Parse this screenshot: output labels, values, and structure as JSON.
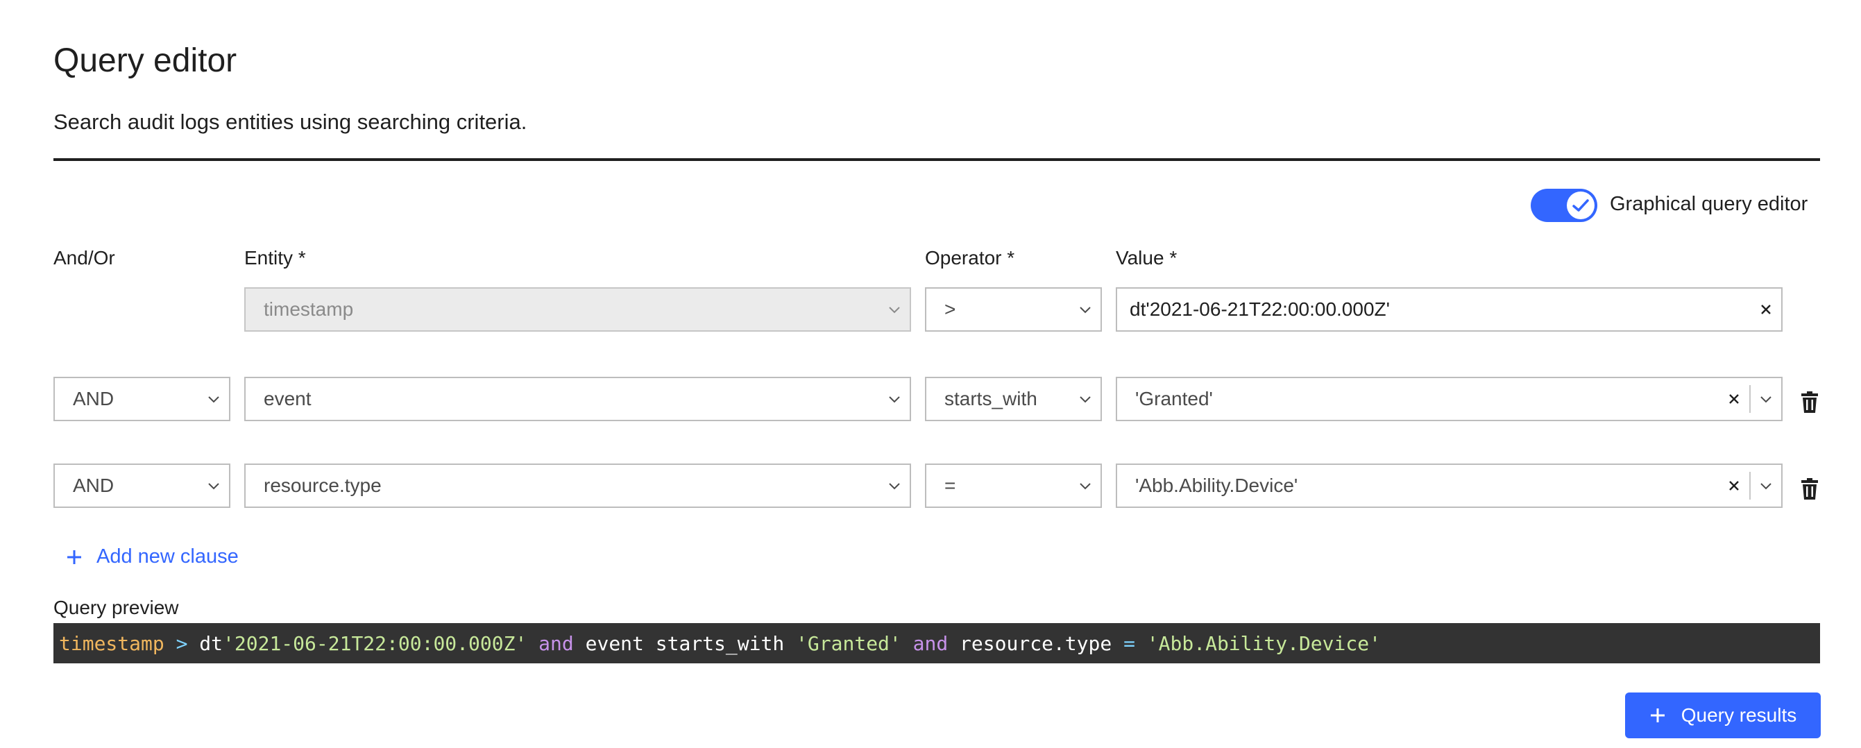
{
  "header": {
    "title": "Query editor",
    "subtitle": "Search audit logs entities using searching criteria."
  },
  "toggle": {
    "label": "Graphical query editor",
    "checked": true,
    "color": "#3366ff"
  },
  "columns": {
    "andor": "And/Or",
    "entity": "Entity *",
    "operator": "Operator *",
    "value": "Value *"
  },
  "clauses": [
    {
      "andor": "",
      "entity": "timestamp",
      "operator": ">",
      "value": "dt'2021-06-21T22:00:00.000Z'"
    },
    {
      "andor": "AND",
      "entity": "event",
      "operator": "starts_with",
      "value": "'Granted'"
    },
    {
      "andor": "AND",
      "entity": "resource.type",
      "operator": "=",
      "value": "'Abb.Ability.Device'"
    }
  ],
  "add_clause": {
    "label": "Add new clause"
  },
  "preview": {
    "label": "Query preview",
    "tokens": [
      {
        "t": "timestamp",
        "k": "ent"
      },
      {
        "t": " ",
        "k": "plain"
      },
      {
        "t": ">",
        "k": "op"
      },
      {
        "t": " dt",
        "k": "plain"
      },
      {
        "t": "'2021-06-21T22:00:00.000Z'",
        "k": "str"
      },
      {
        "t": " ",
        "k": "plain"
      },
      {
        "t": "and",
        "k": "kw"
      },
      {
        "t": " event starts_with ",
        "k": "plain"
      },
      {
        "t": "'Granted'",
        "k": "str"
      },
      {
        "t": " ",
        "k": "plain"
      },
      {
        "t": "and",
        "k": "kw"
      },
      {
        "t": " resource.type ",
        "k": "plain"
      },
      {
        "t": "=",
        "k": "op"
      },
      {
        "t": " ",
        "k": "plain"
      },
      {
        "t": "'Abb.Ability.Device'",
        "k": "str"
      }
    ]
  },
  "actions": {
    "query_results": "Query results"
  },
  "icons": {
    "toggle_check": "check-icon",
    "chevron": "chevron-down-icon",
    "clear": "close-icon",
    "delete": "trash-icon",
    "add": "plus-icon"
  }
}
